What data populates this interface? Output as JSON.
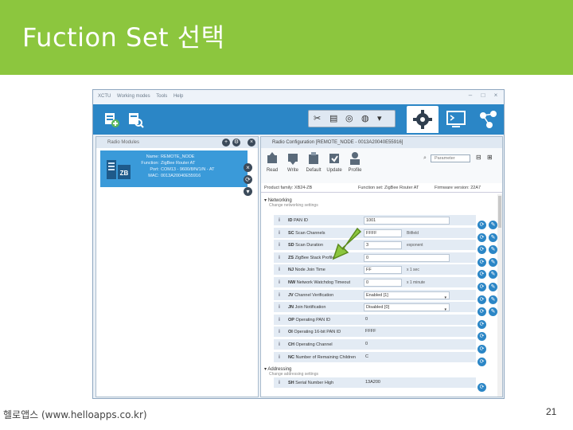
{
  "slide": {
    "title": "Fuction Set 선택",
    "footer": "헬로앱스 (www.helloapps.co.kr)",
    "page_number": "21",
    "accent_color": "#8cc63e"
  },
  "app": {
    "menu": [
      "XCTU",
      "Working modes",
      "Tools",
      "Help"
    ],
    "toolbar_icons": [
      "add-device-icon",
      "discover-devices-icon",
      "tools-icon",
      "console-icon",
      "network-icon",
      "configuration-gear-icon"
    ]
  },
  "left_panel": {
    "title": "Radio Modules",
    "device": {
      "badge": "ZB",
      "rows": [
        {
          "k": "Name:",
          "v": "REMOTE_NODE"
        },
        {
          "k": "Function:",
          "v": "ZigBee Router AT"
        },
        {
          "k": "Port:",
          "v": "COM13 - 9600/8/N/1/N - AT"
        },
        {
          "k": "MAC:",
          "v": "0013A20040E55916"
        }
      ]
    }
  },
  "right_panel": {
    "header": "Radio Configuration [REMOTE_NODE - 0013A20040E55916]",
    "actions": [
      "Read",
      "Write",
      "Default",
      "Update",
      "Profile"
    ],
    "param_placeholder": "Parameter",
    "summary": {
      "product": "Product family: XB24-ZB",
      "function": "Function set: ZigBee Router AT",
      "firmware": "Firmware version: 22A7"
    },
    "sections": [
      {
        "name": "Networking",
        "desc": "Change networking settings"
      },
      {
        "name": "Addressing",
        "desc": "Change addressing settings"
      }
    ],
    "rows": [
      {
        "code": "ID",
        "label": "PAN ID",
        "value": "1001",
        "unit": "",
        "wide": true,
        "dropdown": false,
        "plain": false
      },
      {
        "code": "SC",
        "label": "Scan Channels",
        "value": "FFFF",
        "unit": "Bitfield",
        "wide": false,
        "dropdown": false,
        "plain": false
      },
      {
        "code": "SD",
        "label": "Scan Duration",
        "value": "3",
        "unit": "exponent",
        "wide": false,
        "dropdown": false,
        "plain": false
      },
      {
        "code": "ZS",
        "label": "ZigBee Stack Profile",
        "value": "0",
        "unit": "",
        "wide": true,
        "dropdown": false,
        "plain": false
      },
      {
        "code": "NJ",
        "label": "Node Join Time",
        "value": "FF",
        "unit": "x 1 sec",
        "wide": false,
        "dropdown": false,
        "plain": false
      },
      {
        "code": "NW",
        "label": "Network Watchdog Timeout",
        "value": "0",
        "unit": "x 1 minute",
        "wide": false,
        "dropdown": false,
        "plain": false
      },
      {
        "code": "JV",
        "label": "Channel Verification",
        "value": "Enabled [1]",
        "unit": "",
        "wide": true,
        "dropdown": true,
        "plain": false
      },
      {
        "code": "JN",
        "label": "Join Notification",
        "value": "Disabled [0]",
        "unit": "",
        "wide": true,
        "dropdown": true,
        "plain": false
      },
      {
        "code": "OP",
        "label": "Operating PAN ID",
        "value": "0",
        "unit": "",
        "wide": false,
        "dropdown": false,
        "plain": true
      },
      {
        "code": "OI",
        "label": "Operating 16-bit PAN ID",
        "value": "FFFF",
        "unit": "",
        "wide": false,
        "dropdown": false,
        "plain": true
      },
      {
        "code": "CH",
        "label": "Operating Channel",
        "value": "0",
        "unit": "",
        "wide": false,
        "dropdown": false,
        "plain": true
      },
      {
        "code": "NC",
        "label": "Number of Remaining Children",
        "value": "C",
        "unit": "",
        "wide": false,
        "dropdown": false,
        "plain": true
      },
      {
        "code": "SH",
        "label": "Serial Number High",
        "value": "13A200",
        "unit": "",
        "wide": false,
        "dropdown": false,
        "plain": true
      }
    ]
  }
}
